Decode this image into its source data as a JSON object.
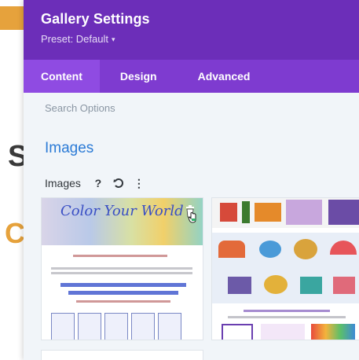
{
  "modal": {
    "title": "Gallery Settings",
    "preset_label": "Preset: Default",
    "preset_caret_icon": "caret-down-icon"
  },
  "tabs": [
    {
      "label": "Content",
      "active": true
    },
    {
      "label": "Design",
      "active": false
    },
    {
      "label": "Advanced",
      "active": false
    }
  ],
  "search": {
    "placeholder": "Search Options"
  },
  "section": {
    "title": "Images",
    "field_label": "Images",
    "help_icon": "question-icon",
    "reset_icon": "undo-icon",
    "more_icon": "more-vertical-icon"
  },
  "gallery": {
    "images": [
      {
        "name": "reading-contest-flyer",
        "heading": "Color Your World",
        "delete_icon": "trash-icon"
      },
      {
        "name": "crafts-collage"
      }
    ]
  },
  "colors": {
    "header_bg": "#6c2eb9",
    "tabs_bg": "#7e3bd0",
    "active_tab_bg": "#8f4be2",
    "section_title": "#2c7bd6",
    "panel_bg": "#f1f5f9"
  }
}
